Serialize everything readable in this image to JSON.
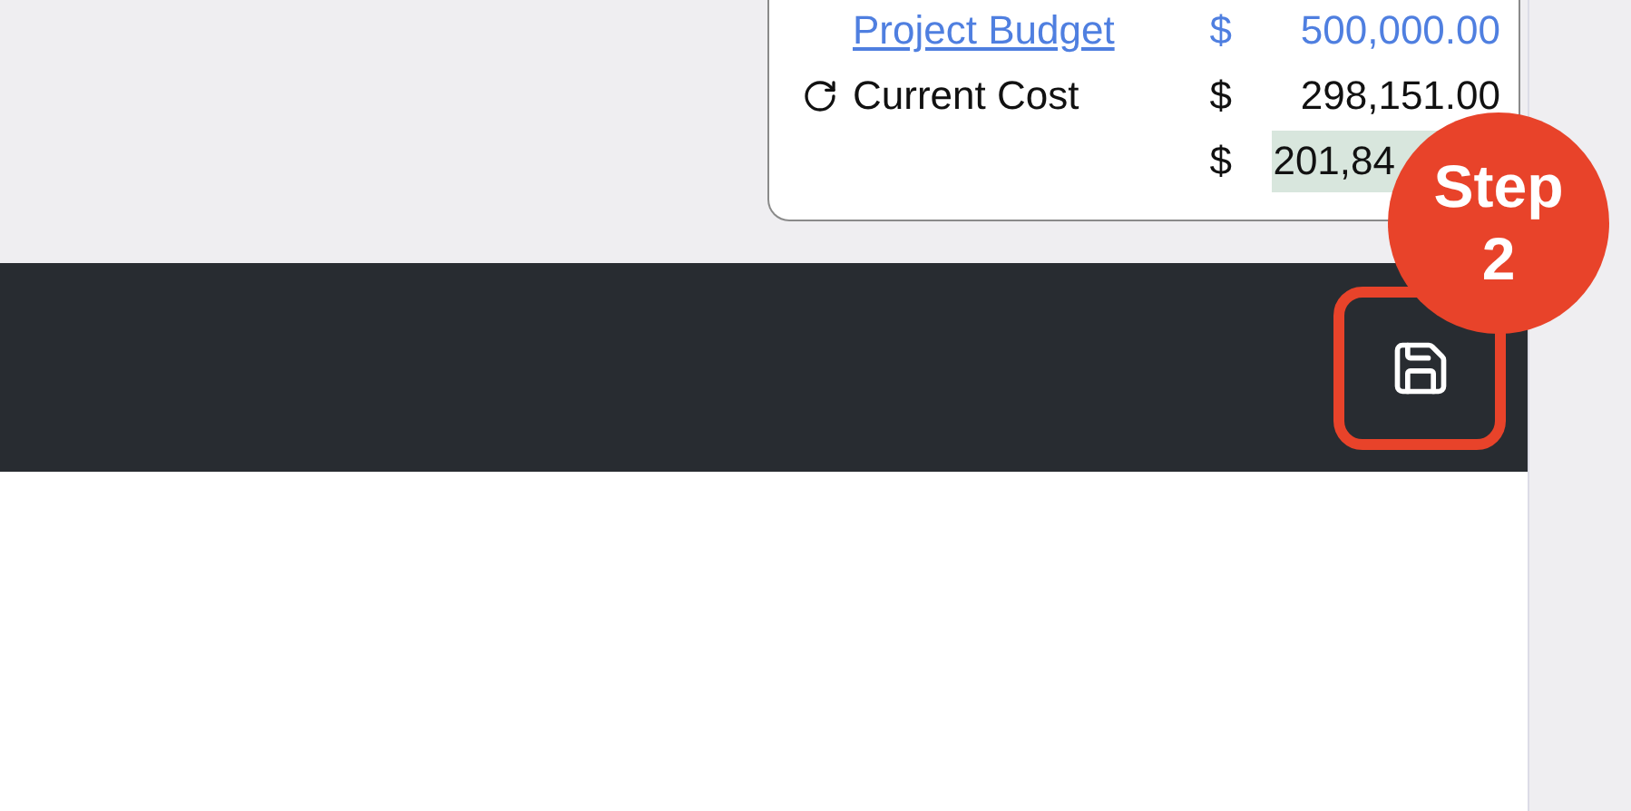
{
  "summary": [
    {
      "kind": "link",
      "label": "Project Budget",
      "currency": "$",
      "value": "500,000.00",
      "highlighted": false
    },
    {
      "kind": "refresh",
      "label": "Current Cost",
      "currency": "$",
      "value": "298,151.00",
      "highlighted": false
    },
    {
      "kind": "plain",
      "currency": "$",
      "value": "201,84",
      "highlighted": true
    }
  ],
  "toolbar": {
    "save_button": {
      "outlined": true
    }
  },
  "step_badge": {
    "title": "Step",
    "number": "2"
  }
}
